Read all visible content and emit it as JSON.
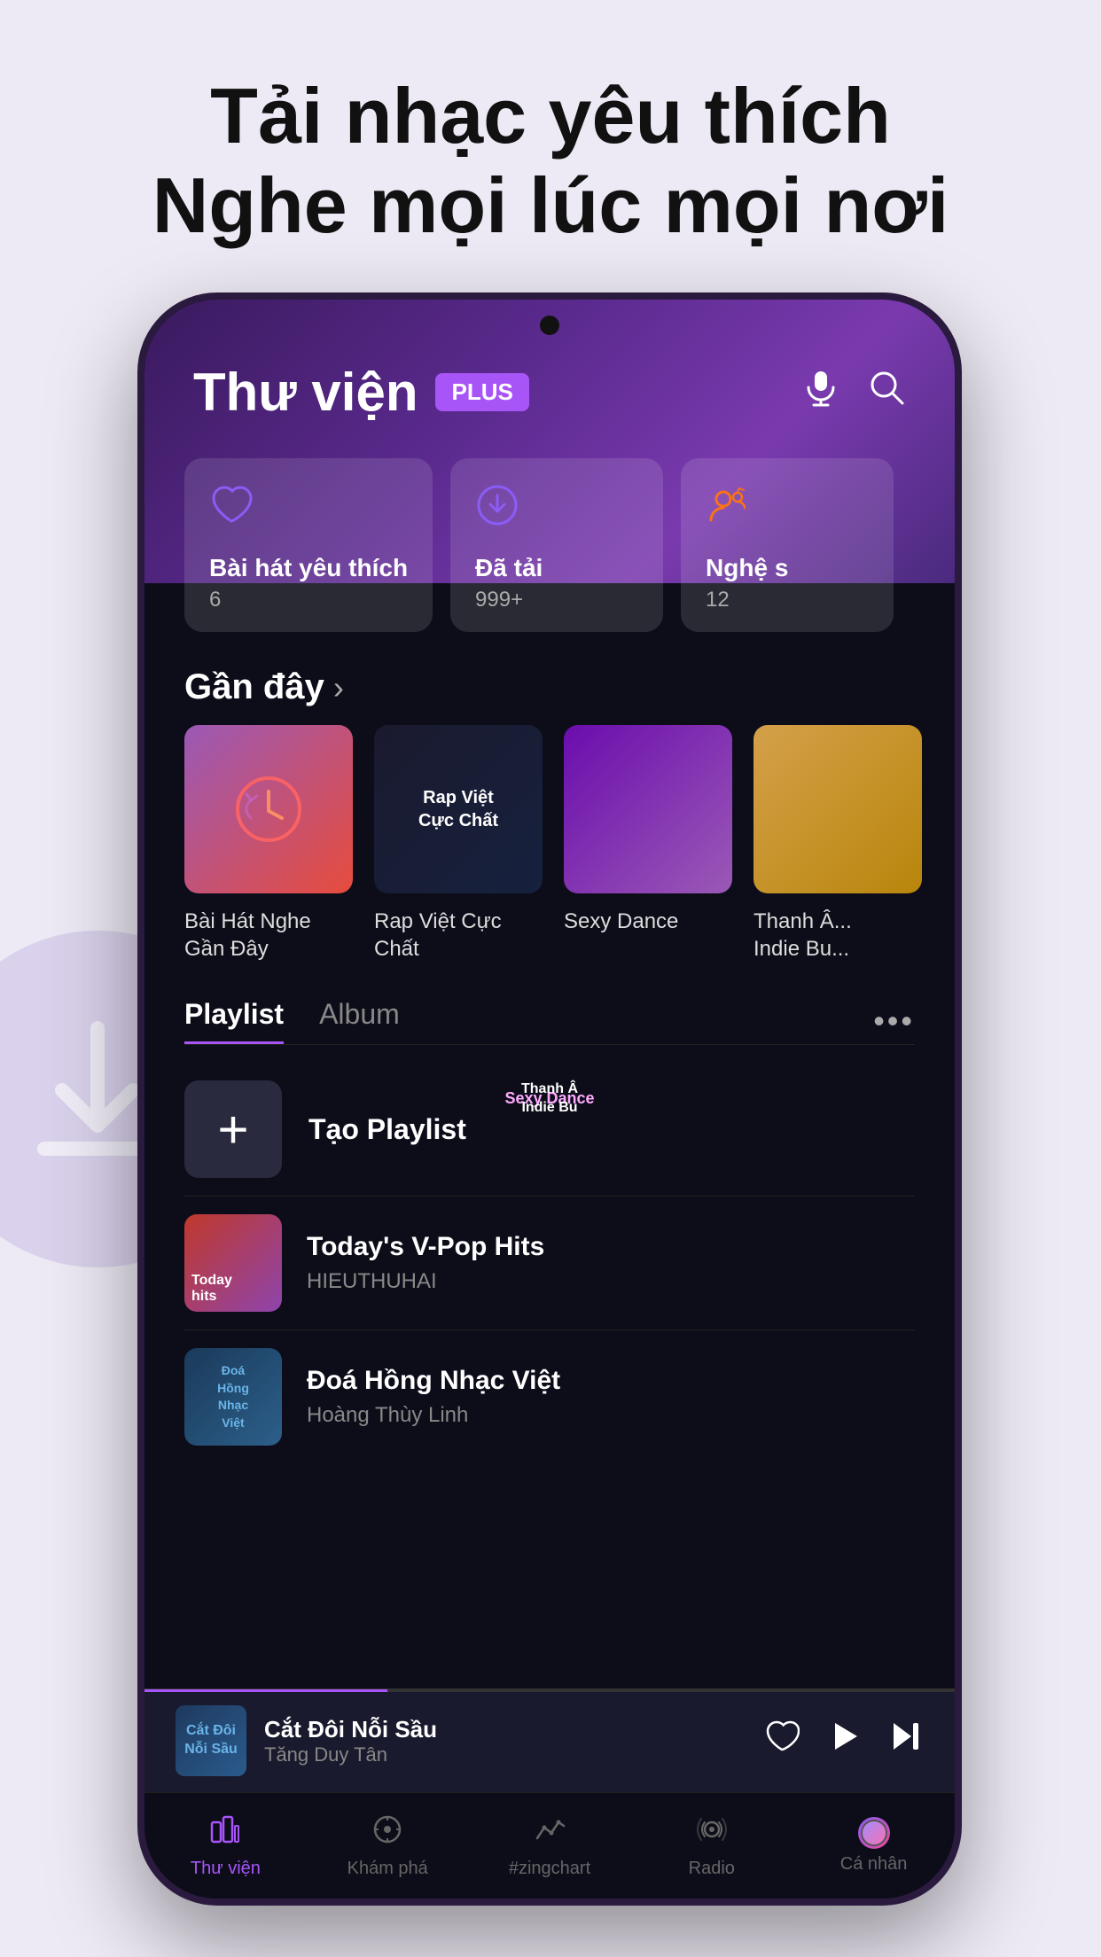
{
  "page": {
    "background": "#eeeaf5",
    "headline_line1": "Tải nhạc yêu thích",
    "headline_line2": "Nghe mọi lúc mọi nơi"
  },
  "app": {
    "title": "Thư viện",
    "plus_badge": "PLUS",
    "header": {
      "mic_icon": "microphone-icon",
      "search_icon": "search-icon"
    },
    "quick_cards": [
      {
        "icon": "heart-icon",
        "title": "Bài hát yêu thích",
        "count": "6",
        "icon_color": "#8B5CF6"
      },
      {
        "icon": "download-icon",
        "title": "Đã tải",
        "count": "999+",
        "icon_color": "#8B5CF6"
      },
      {
        "icon": "artist-icon",
        "title": "Nghệ s",
        "count": "12",
        "icon_color": "#F97316"
      }
    ],
    "recent_section": {
      "label": "Gần đây",
      "items": [
        {
          "title": "Bài Hát Nghe Gần Đây",
          "thumb_type": "clock"
        },
        {
          "title": "Rap Việt Cực Chất",
          "thumb_type": "rap"
        },
        {
          "title": "Sexy Dance",
          "thumb_type": "sexy"
        },
        {
          "title": "Thanh Â... Indie Bu...",
          "thumb_type": "thanh"
        }
      ]
    },
    "tabs": [
      {
        "label": "Playlist",
        "active": true
      },
      {
        "label": "Album",
        "active": false
      }
    ],
    "tab_more": "•••",
    "create_playlist_label": "Tạo Playlist",
    "playlists": [
      {
        "name": "Today's V-Pop Hits",
        "artist": "HIEUTHUHAI",
        "thumb_type": "vpop"
      },
      {
        "name": "Đoá Hồng Nhạc Việt",
        "artist": "Hoàng Thùy Linh",
        "thumb_type": "doahong"
      }
    ],
    "mini_player": {
      "title": "Cắt Đôi Nỗi Sầu",
      "artist": "Tăng Duy Tân",
      "progress": 30,
      "heart_icon": "heart-icon",
      "play_icon": "play-icon",
      "next_icon": "next-icon"
    },
    "bottom_nav": [
      {
        "label": "Thư viện",
        "icon": "library-icon",
        "active": true
      },
      {
        "label": "Khám phá",
        "icon": "explore-icon",
        "active": false
      },
      {
        "label": "#zingchart",
        "icon": "chart-icon",
        "active": false
      },
      {
        "label": "Radio",
        "icon": "radio-icon",
        "active": false
      },
      {
        "label": "Cá nhân",
        "icon": "profile-icon",
        "active": false
      }
    ]
  }
}
